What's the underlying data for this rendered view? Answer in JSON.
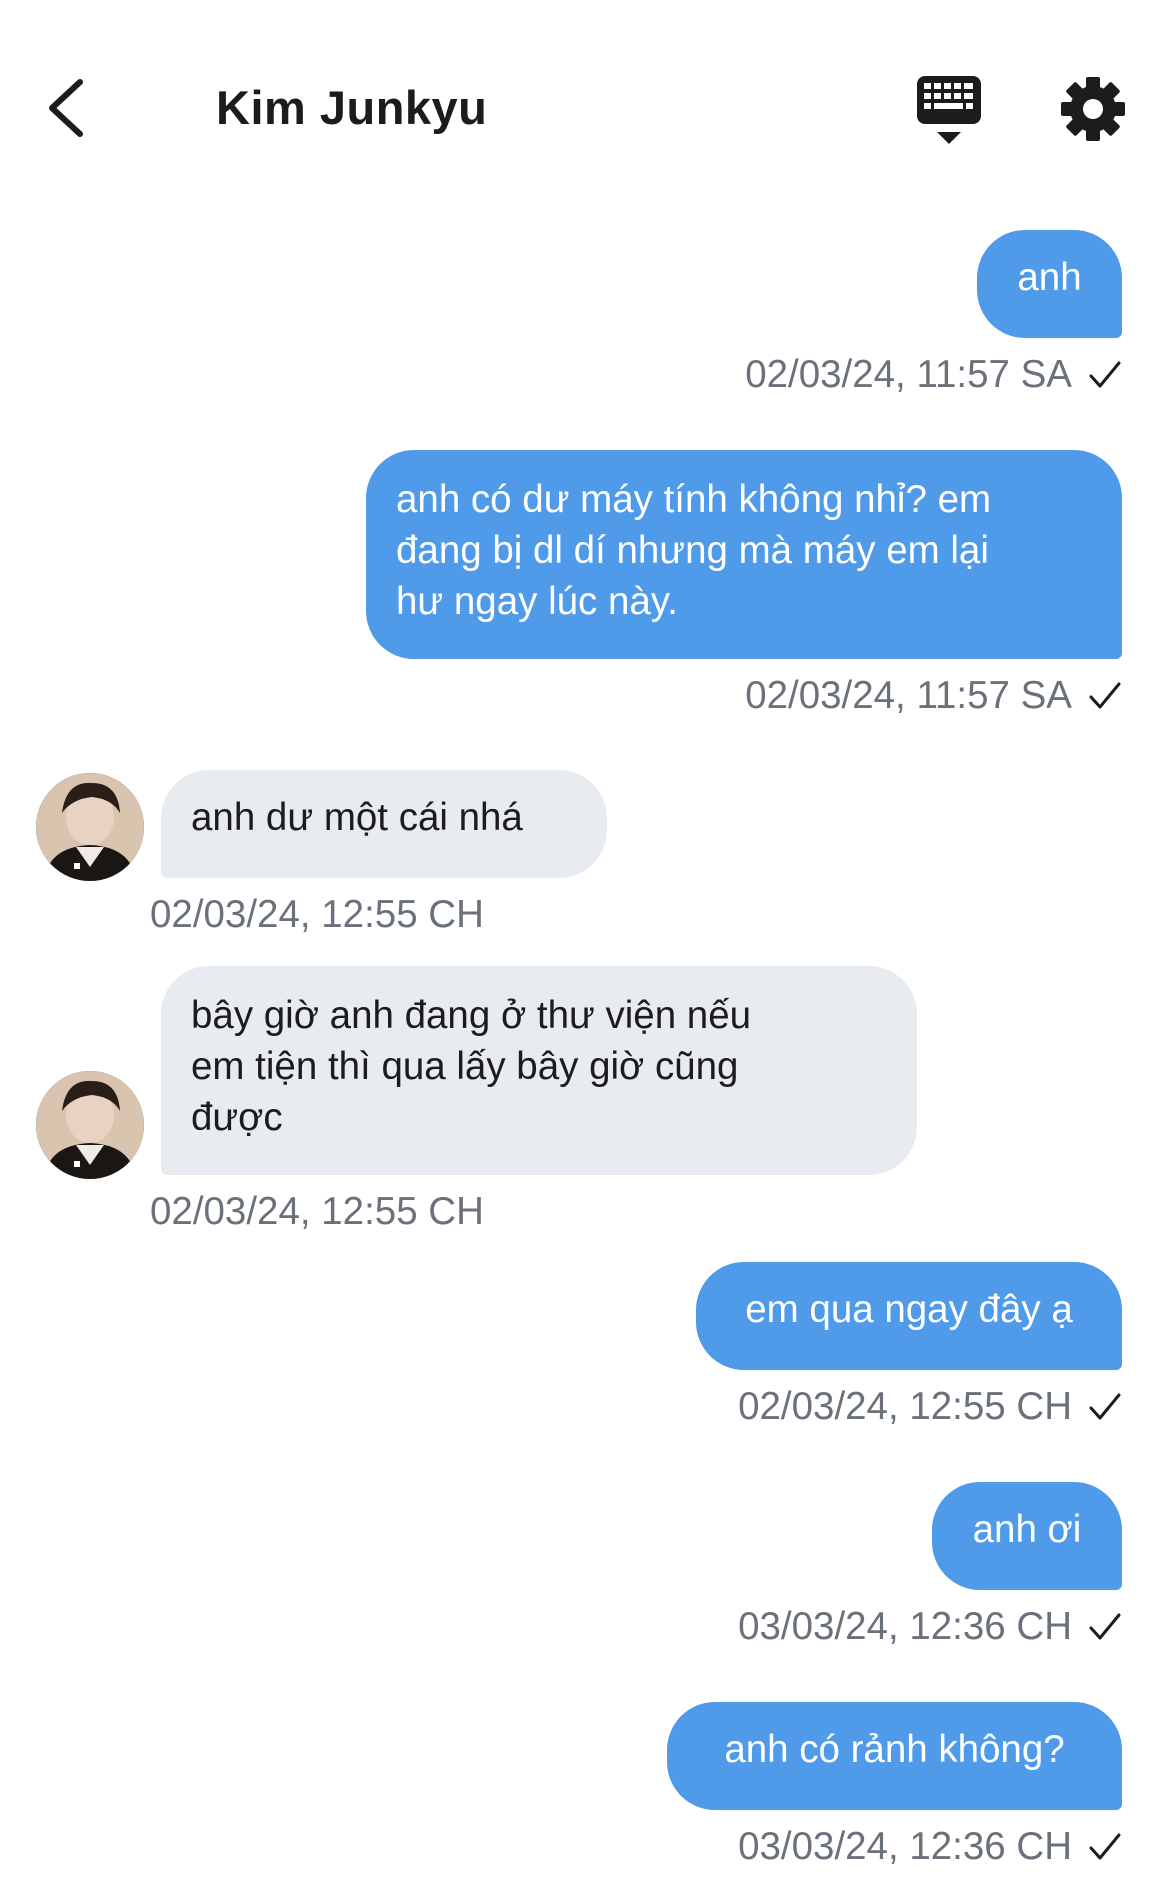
{
  "header": {
    "title": "Kim Junkyu",
    "back_icon": "chevron-left-icon",
    "keyboard_icon": "keyboard-icon",
    "settings_icon": "gear-icon"
  },
  "colors": {
    "outgoing_bubble": "#4f9ae9",
    "incoming_bubble": "#e8ebef",
    "timestamp": "#6b717b"
  },
  "messages": [
    {
      "direction": "out",
      "text": "anh",
      "time": "02/03/24, 11:57 SA",
      "status": "sent"
    },
    {
      "direction": "out",
      "text": "anh có dư máy tính không nhỉ? em\nđang bị dl dí nhưng mà máy em lại\như ngay lúc này.",
      "time": "02/03/24, 11:57 SA",
      "status": "sent"
    },
    {
      "direction": "in",
      "text": "anh dư một cái nhá",
      "time": "02/03/24, 12:55 CH"
    },
    {
      "direction": "in",
      "text": "bây giờ anh đang ở thư viện nếu\nem tiện thì qua lấy bây giờ cũng\nđược",
      "time": "02/03/24, 12:55 CH"
    },
    {
      "direction": "out",
      "text": "em qua ngay đây ạ",
      "time": "02/03/24, 12:55 CH",
      "status": "sent"
    },
    {
      "direction": "out",
      "text": "anh ơi",
      "time": "03/03/24, 12:36 CH",
      "status": "sent"
    },
    {
      "direction": "out",
      "text": "anh có rảnh không?",
      "time": "03/03/24, 12:36 CH",
      "status": "sent"
    }
  ]
}
